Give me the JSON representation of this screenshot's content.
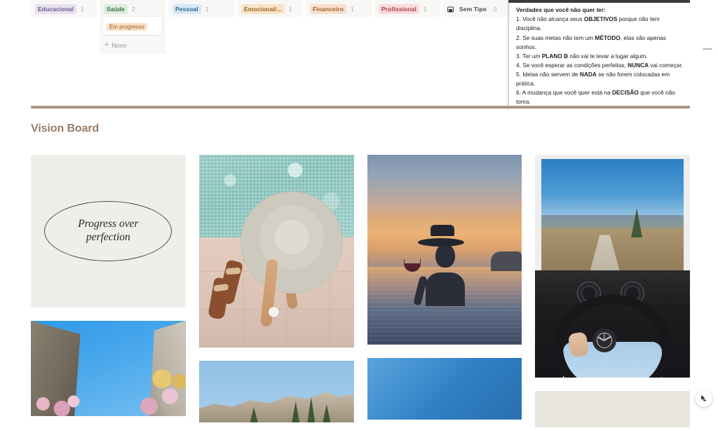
{
  "kanban": {
    "columns": [
      {
        "label": "Educacional",
        "count": "1",
        "chip_bg": "#e8e0f2",
        "chip_fg": "#6b5a8a",
        "icon": null,
        "cards": [],
        "show_new": false
      },
      {
        "label": "Saúde",
        "count": "2",
        "chip_bg": "#dcefdc",
        "chip_fg": "#3f6b45",
        "icon": null,
        "cards": [
          {
            "tag": "Em progresso",
            "tag_bg": "#fadfc4",
            "tag_fg": "#9a5b2a"
          }
        ],
        "show_new": true,
        "new_label": "Novo"
      },
      {
        "label": "Pessoal",
        "count": "1",
        "chip_bg": "#d8e9f5",
        "chip_fg": "#2f6488",
        "icon": null,
        "cards": [],
        "show_new": false
      },
      {
        "label": "Emocional/...",
        "count": "1",
        "chip_bg": "#fae3c6",
        "chip_fg": "#95642c",
        "icon": null,
        "cards": [],
        "show_new": false
      },
      {
        "label": "Financeiro",
        "count": "1",
        "chip_bg": "#fbe0cc",
        "chip_fg": "#96612f",
        "icon": null,
        "cards": [],
        "show_new": false
      },
      {
        "label": "Profissional",
        "count": "1",
        "chip_bg": "#fbd9dc",
        "chip_fg": "#9c4450",
        "icon": null,
        "cards": [],
        "show_new": false
      },
      {
        "label": "Sem Tipo",
        "count": "0",
        "chip_bg": "transparent",
        "chip_fg": "#4a4845",
        "icon": "window-icon",
        "cards": [],
        "show_new": false
      }
    ]
  },
  "quote": {
    "title": "Verdades que você não quer ler:",
    "lines": [
      {
        "pre": "1. Você não alcança seus ",
        "bold": "OBJETIVOS",
        "post": " porque não tem disciplina."
      },
      {
        "pre": "2. Se suas metas não tem um ",
        "bold": "MÉTODO",
        "post": ", elas são apenas sonhos."
      },
      {
        "pre": "3. Ter um ",
        "bold": "PLANO B",
        "post": " não vai te levar a lugar algum."
      },
      {
        "pre": "4. Se você esperar as condições perfeitas, ",
        "bold": "NUNCA",
        "post": " vai começar."
      },
      {
        "pre": "5. Ideias não servem de ",
        "bold": "NADA",
        "post": " se não forem colocadas em prática."
      },
      {
        "pre": "6. A mudança que você quer está na ",
        "bold": "DECISÃO",
        "post": " que você não toma."
      }
    ]
  },
  "section": {
    "title": "Vision Board",
    "title_color": "#9a7b63",
    "divider_color": "#ab9684"
  },
  "gallery": {
    "tiles": [
      {
        "name": "quote-card-progress-over-perfection",
        "kind": "text-card",
        "text_line_1": "Progress over",
        "text_line_2": "perfection"
      },
      {
        "name": "photo-poolside-sunhat",
        "kind": "photo",
        "alt": "Top-down photo of woman in straw sun hat lying beside teal mosaic pool"
      },
      {
        "name": "photo-sunset-infinity-pool",
        "kind": "photo",
        "alt": "Silhouette of woman with hat holding wine glass in infinity pool at sunset"
      },
      {
        "name": "photo-car-interior-mercedes",
        "kind": "photo",
        "alt": "Driver point of view behind Mercedes steering wheel on mountain road"
      },
      {
        "name": "photo-buildings-blue-sky",
        "kind": "photo",
        "alt": "Looking up at old buildings with flowers against blue sky"
      },
      {
        "name": "photo-rocky-mountain-ridge",
        "kind": "photo",
        "alt": "Rocky mountain ridge with pine trees under blue sky"
      },
      {
        "name": "photo-blue-sky",
        "kind": "photo",
        "alt": "Clear blue sky gradient"
      },
      {
        "name": "cream-blank-card",
        "kind": "blank",
        "alt": "Blank cream colored card"
      }
    ]
  },
  "controls": {
    "collapse_handle": "collapse-handle",
    "fab": "cursor-move-button"
  }
}
